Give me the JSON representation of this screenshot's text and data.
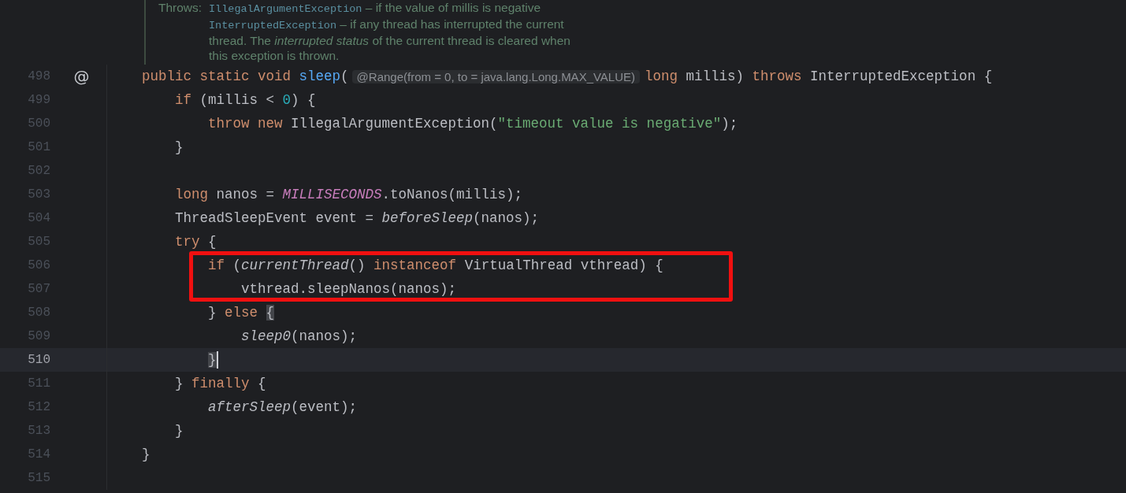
{
  "doc": {
    "label": "Throws:",
    "lines": [
      [
        {
          "kind": "code",
          "text": "IllegalArgumentException"
        },
        {
          "kind": "text",
          "text": " – if the value of millis is negative"
        }
      ],
      [
        {
          "kind": "code",
          "text": "InterruptedException"
        },
        {
          "kind": "text",
          "text": " – if any thread has interrupted the current"
        }
      ],
      [
        {
          "kind": "text",
          "text": "thread. The *interrupted status* of the current thread is cleared when"
        }
      ],
      [
        {
          "kind": "text",
          "text": "this exception is thrown."
        }
      ]
    ]
  },
  "lines": [
    {
      "number": "498",
      "marker": "@",
      "current": false,
      "boxed": false,
      "tokens": [
        {
          "kind": "kw",
          "text": "    public static void "
        },
        {
          "kind": "fn",
          "text": "sleep"
        },
        {
          "kind": "plain",
          "text": "("
        },
        {
          "kind": "hint",
          "text": "@Range(from = 0, to = java.lang.Long.MAX_VALUE)"
        },
        {
          "kind": "kw",
          "text": "long "
        },
        {
          "kind": "plain",
          "text": "millis) "
        },
        {
          "kind": "kw",
          "text": "throws "
        },
        {
          "kind": "plain",
          "text": "InterruptedException {"
        }
      ]
    },
    {
      "number": "499",
      "current": false,
      "boxed": false,
      "tokens": [
        {
          "kind": "kw",
          "text": "        if "
        },
        {
          "kind": "plain",
          "text": "(millis < "
        },
        {
          "kind": "num",
          "text": "0"
        },
        {
          "kind": "plain",
          "text": ") {"
        }
      ]
    },
    {
      "number": "500",
      "current": false,
      "boxed": false,
      "tokens": [
        {
          "kind": "kw",
          "text": "            throw new "
        },
        {
          "kind": "plain",
          "text": "IllegalArgumentException("
        },
        {
          "kind": "str",
          "text": "\"timeout value is negative\""
        },
        {
          "kind": "plain",
          "text": ");"
        }
      ]
    },
    {
      "number": "501",
      "current": false,
      "boxed": false,
      "tokens": [
        {
          "kind": "plain",
          "text": "        }"
        }
      ]
    },
    {
      "number": "502",
      "current": false,
      "boxed": false
    },
    {
      "number": "503",
      "current": false,
      "boxed": false,
      "tokens": [
        {
          "kind": "kw",
          "text": "        long "
        },
        {
          "kind": "plain",
          "text": "nanos = "
        },
        {
          "kind": "const",
          "text": "MILLISECONDS"
        },
        {
          "kind": "plain",
          "text": ".toNanos(millis);"
        }
      ]
    },
    {
      "number": "504",
      "current": false,
      "boxed": false,
      "tokens": [
        {
          "kind": "plain",
          "text": "        ThreadSleepEvent event = "
        },
        {
          "kind": "call",
          "text": "beforeSleep"
        },
        {
          "kind": "plain",
          "text": "(nanos);"
        }
      ]
    },
    {
      "number": "505",
      "current": false,
      "boxed": false,
      "tokens": [
        {
          "kind": "kw",
          "text": "        try "
        },
        {
          "kind": "plain",
          "text": "{"
        }
      ]
    },
    {
      "number": "506",
      "current": false,
      "boxed": true,
      "tokens": [
        {
          "kind": "kw",
          "text": "            if "
        },
        {
          "kind": "plain",
          "text": "("
        },
        {
          "kind": "call",
          "text": "currentThread"
        },
        {
          "kind": "plain",
          "text": "() "
        },
        {
          "kind": "kw",
          "text": "instanceof "
        },
        {
          "kind": "plain",
          "text": "VirtualThread vthread) {"
        }
      ]
    },
    {
      "number": "507",
      "current": false,
      "boxed": true,
      "tokens": [
        {
          "kind": "plain",
          "text": "                vthread.sleepNanos(nanos);"
        }
      ]
    },
    {
      "number": "508",
      "current": false,
      "boxed": false,
      "tokens": [
        {
          "kind": "plain",
          "text": "            } "
        },
        {
          "kind": "kw",
          "text": "else "
        },
        {
          "kind": "match",
          "text": "{"
        }
      ]
    },
    {
      "number": "509",
      "current": false,
      "boxed": false,
      "tokens": [
        {
          "kind": "call",
          "text": "                sleep0"
        },
        {
          "kind": "plain",
          "text": "(nanos);"
        }
      ]
    },
    {
      "number": "510",
      "current": true,
      "boxed": false,
      "tokens": [
        {
          "kind": "match",
          "text": "            }"
        }
      ]
    },
    {
      "number": "511",
      "current": false,
      "boxed": false,
      "tokens": [
        {
          "kind": "plain",
          "text": "        } "
        },
        {
          "kind": "kw",
          "text": "finally "
        },
        {
          "kind": "plain",
          "text": "{"
        }
      ]
    },
    {
      "number": "512",
      "current": false,
      "boxed": false,
      "tokens": [
        {
          "kind": "call",
          "text": "            afterSleep"
        },
        {
          "kind": "plain",
          "text": "(event);"
        }
      ]
    },
    {
      "number": "513",
      "current": false,
      "boxed": false,
      "tokens": [
        {
          "kind": "plain",
          "text": "        }"
        }
      ]
    },
    {
      "number": "514",
      "current": false,
      "boxed": false,
      "tokens": [
        {
          "kind": "plain",
          "text": "    }"
        }
      ]
    },
    {
      "number": "515",
      "current": false,
      "boxed": false
    }
  ]
}
